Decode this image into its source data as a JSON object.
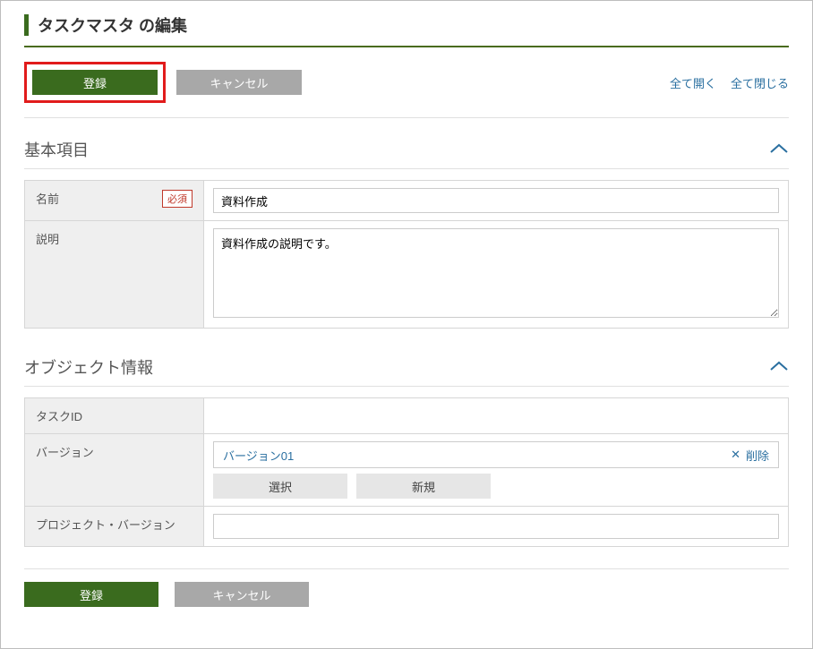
{
  "page": {
    "title": "タスクマスタ の編集"
  },
  "actions": {
    "register": "登録",
    "cancel": "キャンセル",
    "open_all": "全て開く",
    "close_all": "全て閉じる"
  },
  "sections": {
    "basic": {
      "title": "基本項目",
      "fields": {
        "name_label": "名前",
        "name_required": "必須",
        "name_value": "資料作成",
        "desc_label": "説明",
        "desc_value": "資料作成の説明です。"
      }
    },
    "object": {
      "title": "オブジェクト情報",
      "fields": {
        "taskid_label": "タスクID",
        "taskid_value": "",
        "version_label": "バージョン",
        "version_value": "バージョン01",
        "version_delete": "削除",
        "version_select": "選択",
        "version_new": "新規",
        "projver_label": "プロジェクト・バージョン",
        "projver_value": ""
      }
    }
  },
  "footer": {
    "register": "登録",
    "cancel": "キャンセル"
  }
}
